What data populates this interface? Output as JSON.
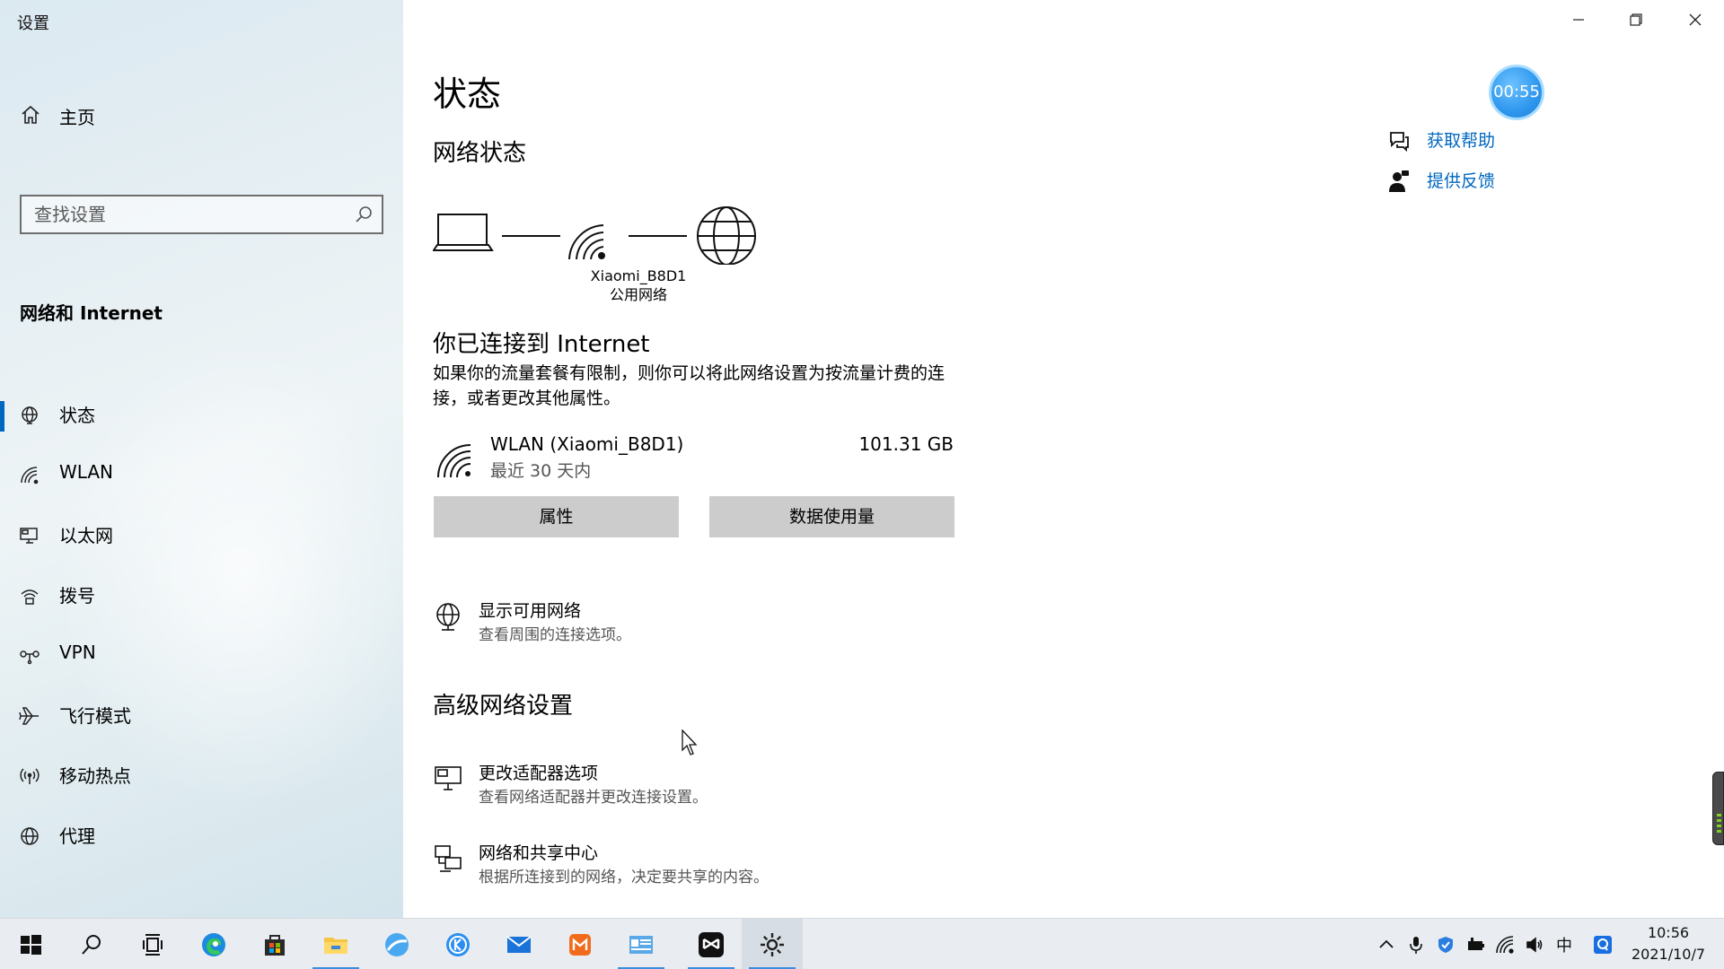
{
  "window": {
    "title": "设置",
    "controls": {
      "minimize_icon": "minimize-icon",
      "restore_icon": "restore-icon",
      "close_icon": "close-icon"
    }
  },
  "sidebar": {
    "home_label": "主页",
    "search_placeholder": "查找设置",
    "section_title": "网络和 Internet",
    "items": [
      {
        "label": "状态",
        "icon": "status-globe-icon",
        "active": true
      },
      {
        "label": "WLAN",
        "icon": "wifi-icon"
      },
      {
        "label": "以太网",
        "icon": "ethernet-icon"
      },
      {
        "label": "拨号",
        "icon": "dialup-icon"
      },
      {
        "label": "VPN",
        "icon": "vpn-icon"
      },
      {
        "label": "飞行模式",
        "icon": "airplane-icon"
      },
      {
        "label": "移动热点",
        "icon": "hotspot-icon"
      },
      {
        "label": "代理",
        "icon": "proxy-globe-icon"
      }
    ]
  },
  "main": {
    "page_title": "状态",
    "network_status_heading": "网络状态",
    "network": {
      "ssid": "Xiaomi_B8D1",
      "type": "公用网络"
    },
    "connected_heading": "你已连接到 Internet",
    "connected_desc": "如果你的流量套餐有限制，则你可以将此网络设置为按流量计费的连接，或者更改其他属性。",
    "connection": {
      "name": "WLAN (Xiaomi_B8D1)",
      "period": "最近 30 天内",
      "usage": "101.31 GB"
    },
    "buttons": {
      "properties": "属性",
      "data_usage": "数据使用量"
    },
    "show_networks": {
      "title": "显示可用网络",
      "desc": "查看周围的连接选项。"
    },
    "advanced_heading": "高级网络设置",
    "advanced_links": [
      {
        "title": "更改适配器选项",
        "desc": "查看网络适配器并更改连接设置。"
      },
      {
        "title": "网络和共享中心",
        "desc": "根据所连接到的网络，决定要共享的内容。"
      }
    ],
    "help": {
      "get_help": "获取帮助",
      "feedback": "提供反馈"
    },
    "timer": "00:55"
  },
  "taskbar": {
    "apps": [
      "start-icon",
      "search-icon",
      "task-view-icon",
      "edge-icon",
      "store-icon",
      "file-explorer-icon",
      "browser-icon",
      "kugou-icon",
      "mail-icon",
      "office-icon",
      "control-panel-icon",
      "capcut-icon",
      "settings-icon"
    ],
    "clock": {
      "time": "10:56",
      "date": "2021/10/7"
    },
    "ime": "中"
  },
  "colors": {
    "accent": "#0067c0",
    "sidebar_bg": "#e6eff3",
    "button_bg": "#cccccc",
    "taskbar_bg": "#e9edf1"
  }
}
